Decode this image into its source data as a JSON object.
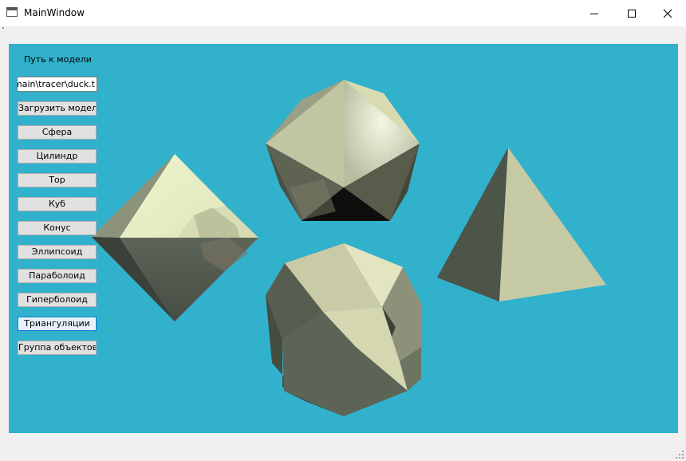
{
  "window": {
    "title": "MainWindow",
    "icon": "app-window-icon",
    "controls": [
      "minimize-icon",
      "maximize-icon",
      "close-icon"
    ]
  },
  "panel": {
    "path_label": "Путь  к модели",
    "path_value": "ry-main\\tracer\\duck.t",
    "buttons": {
      "load": "Загрузить модель",
      "sphere": "Сфера",
      "cylinder": "Цилиндр",
      "torus": "Тор",
      "cube": "Куб",
      "cone": "Конус",
      "ellipsoid": "Эллипсоид",
      "paraboloid": "Параболоид",
      "hyperboloid": "Гиперболоид",
      "triangulations": "Триангуляции",
      "object_group": "Группа объектов"
    },
    "focused_button": "triangulations"
  },
  "scene": {
    "background": "#31b1cc",
    "objects": [
      "octahedron",
      "icosahedron",
      "dodecahedron",
      "tetrahedron"
    ]
  }
}
